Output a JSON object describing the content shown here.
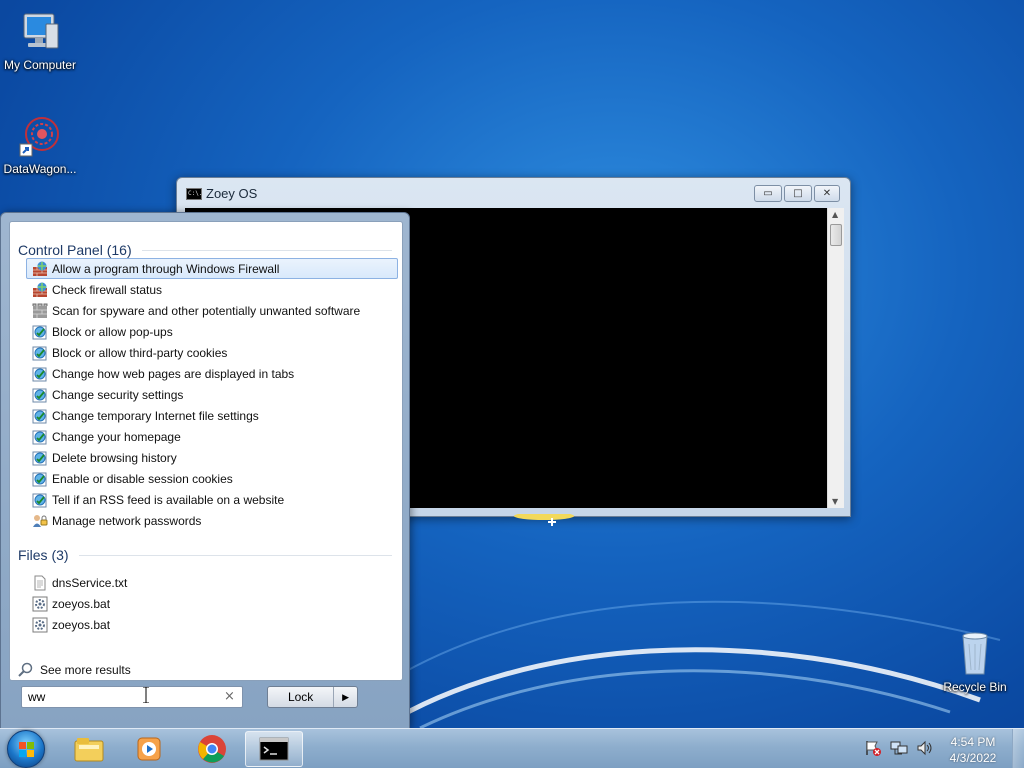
{
  "desktop": {
    "icons": [
      {
        "label": "My Computer",
        "icon": "computer-icon"
      },
      {
        "label": "DataWagon...",
        "icon": "datawagon-shortcut-icon"
      },
      {
        "label": "Recycle Bin",
        "icon": "recycle-bin-icon"
      }
    ]
  },
  "console_window": {
    "title": "Zoey OS",
    "title_icon_text": "C:\\.",
    "buttons": {
      "minimize": "▭",
      "maximize": "□",
      "close": "✕"
    }
  },
  "start_menu": {
    "sections": [
      {
        "heading": "Control Panel (16)",
        "items": [
          {
            "label": "Allow a program through Windows Firewall",
            "icon": "firewall-icon",
            "selected": true
          },
          {
            "label": "Check firewall status",
            "icon": "firewall-icon"
          },
          {
            "label": "Scan for spyware and other potentially unwanted software",
            "icon": "defender-icon"
          },
          {
            "label": "Block or allow pop-ups",
            "icon": "internet-options-icon"
          },
          {
            "label": "Block or allow third-party cookies",
            "icon": "internet-options-icon"
          },
          {
            "label": "Change how web pages are displayed in tabs",
            "icon": "internet-options-icon"
          },
          {
            "label": "Change security settings",
            "icon": "internet-options-icon"
          },
          {
            "label": "Change temporary Internet file settings",
            "icon": "internet-options-icon"
          },
          {
            "label": "Change your homepage",
            "icon": "internet-options-icon"
          },
          {
            "label": "Delete browsing history",
            "icon": "internet-options-icon"
          },
          {
            "label": "Enable or disable session cookies",
            "icon": "internet-options-icon"
          },
          {
            "label": "Tell if an RSS feed is available on a website",
            "icon": "internet-options-icon"
          },
          {
            "label": "Manage network passwords",
            "icon": "user-accounts-icon"
          }
        ]
      },
      {
        "heading": "Files (3)",
        "items": [
          {
            "label": "dnsService.txt",
            "icon": "text-file-icon"
          },
          {
            "label": "zoeyos.bat",
            "icon": "batch-file-icon"
          },
          {
            "label": "zoeyos.bat",
            "icon": "batch-file-icon"
          }
        ]
      }
    ],
    "see_more": "See more results",
    "search": {
      "value": "ww",
      "clear": "×"
    },
    "power_button": {
      "label": "Lock",
      "arrow": "▶"
    }
  },
  "taskbar": {
    "pinned": [
      "file-explorer-icon",
      "media-player-icon",
      "chrome-icon",
      "cmd-icon"
    ],
    "active": "cmd-icon",
    "tray": [
      "action-center-icon",
      "network-icon",
      "volume-icon"
    ],
    "clock": {
      "time": "4:54 PM",
      "date": "4/3/2022"
    }
  },
  "colors": {
    "accent": "#1e3a67",
    "selection": "#d9e9fb",
    "desktop": "#1564c0"
  }
}
